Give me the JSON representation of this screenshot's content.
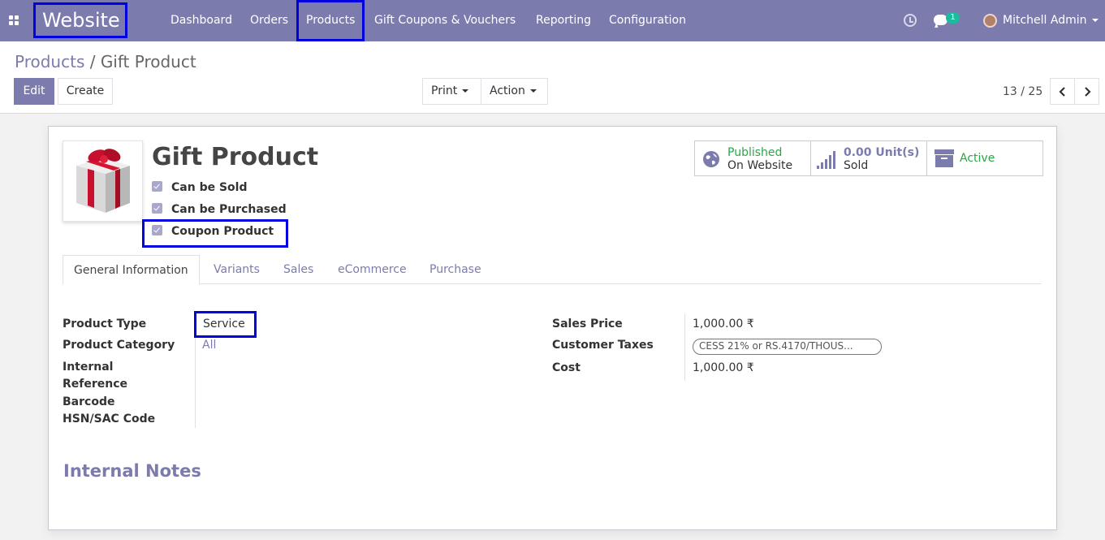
{
  "navbar": {
    "brand": "Website",
    "menu": [
      "Dashboard",
      "Orders",
      "Products",
      "Gift Coupons & Vouchers",
      "Reporting",
      "Configuration"
    ],
    "chat_count": "1",
    "user": "Mitchell Admin"
  },
  "breadcrumb": {
    "parent": "Products",
    "separator": " / ",
    "current": "Gift Product"
  },
  "toolbar": {
    "edit": "Edit",
    "create": "Create",
    "print": "Print",
    "action": "Action"
  },
  "pager": {
    "value": "13 / 25"
  },
  "product": {
    "name": "Gift Product",
    "checkboxes": [
      {
        "label": "Can be Sold",
        "checked": true
      },
      {
        "label": "Can be Purchased",
        "checked": true
      },
      {
        "label": "Coupon Product",
        "checked": true
      }
    ]
  },
  "stat_buttons": {
    "published_line1": "Published",
    "published_line2": "On Website",
    "sold_value": "0.00",
    "sold_unit": "Unit(s)",
    "sold_label": "Sold",
    "active": "Active"
  },
  "tabs": [
    "General Information",
    "Variants",
    "Sales",
    "eCommerce",
    "Purchase"
  ],
  "general": {
    "left_labels": [
      "Product Type",
      "Product Category",
      "Internal",
      "Reference",
      "Barcode",
      "HSN/SAC Code"
    ],
    "product_type": "Service",
    "product_category": "All",
    "right_labels": [
      "Sales Price",
      "Customer Taxes",
      "Cost"
    ],
    "sales_price": "1,000.00 ₹",
    "customer_tax": "CESS 21% or RS.4170/THOUS...",
    "cost": "1,000.00 ₹"
  },
  "notes_title": "Internal Notes",
  "colors": {
    "brand": "#7c7bad",
    "highlight": "#0000e0",
    "success": "#28a745",
    "badge": "#1abc9c"
  }
}
